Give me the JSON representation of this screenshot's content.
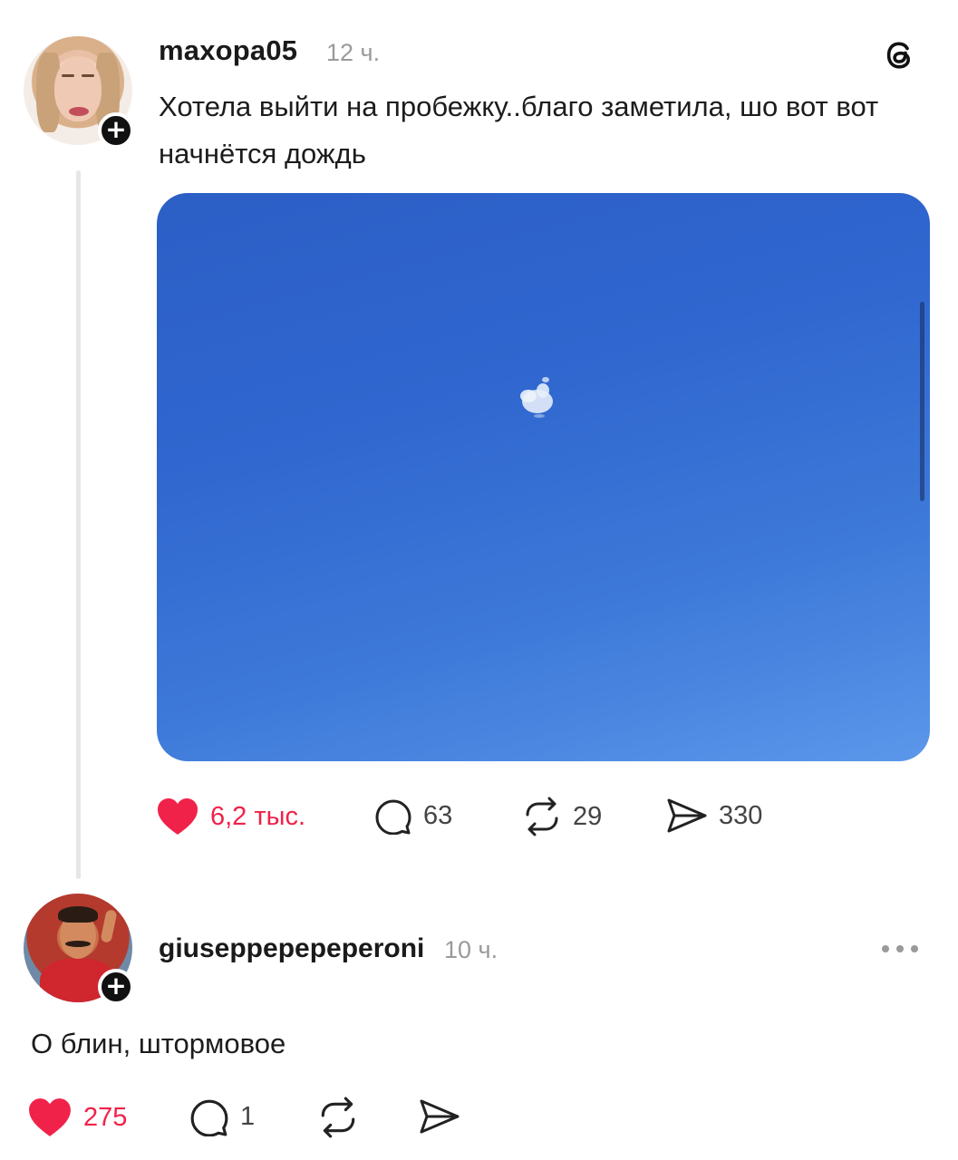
{
  "app": {
    "name": "Threads",
    "accent_color": "#f0224a"
  },
  "post": {
    "username": "maxopa05",
    "time": "12 ч.",
    "text": "Хотела выйти на пробежку..благо заметила, шо вот вот начнётся дождь",
    "image": {
      "description_icon": "sky-photo",
      "sky_color": "#2f66cf"
    },
    "actions": {
      "likes": "6,2 тыс.",
      "comments": "63",
      "reposts": "29",
      "shares": "330",
      "liked": true
    },
    "icons": {
      "app_logo": "threads-logo-icon",
      "follow": "plus-icon",
      "like": "heart-icon",
      "comment": "comment-icon",
      "repost": "repost-icon",
      "share": "send-icon"
    }
  },
  "reply": {
    "username": "giuseppepepeperoni",
    "time": "10 ч.",
    "text": "О блин, штормовое",
    "actions": {
      "likes": "275",
      "comments": "1",
      "liked": true
    },
    "icons": {
      "more": "more-dots-icon",
      "follow": "plus-icon"
    }
  }
}
